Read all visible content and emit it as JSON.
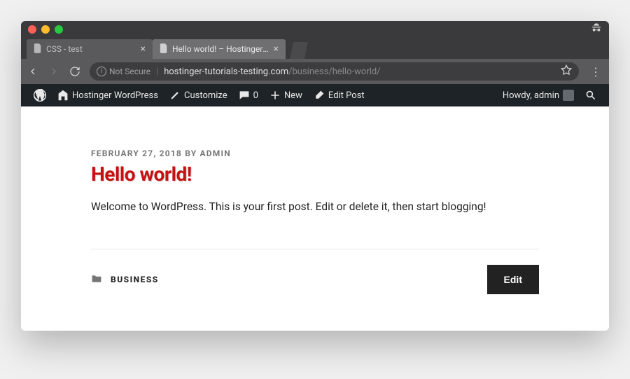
{
  "tabs": {
    "inactive": {
      "title": "CSS - test"
    },
    "active": {
      "title": "Hello world! – Hostinger WordP"
    }
  },
  "addressbar": {
    "not_secure": "Not Secure",
    "host": "hostinger-tutorials-testing.com",
    "path": "/business/hello-world/"
  },
  "adminbar": {
    "site_name": "Hostinger WordPress",
    "customize": "Customize",
    "comments_count": "0",
    "new": "New",
    "edit_post": "Edit Post",
    "howdy": "Howdy, admin"
  },
  "post": {
    "meta_date": "FEBRUARY 27, 2018",
    "meta_by": "BY",
    "meta_author": "ADMIN",
    "title": "Hello world!",
    "body": "Welcome to WordPress. This is your first post. Edit or delete it, then start blogging!",
    "category": "BUSINESS",
    "edit_button": "Edit"
  }
}
